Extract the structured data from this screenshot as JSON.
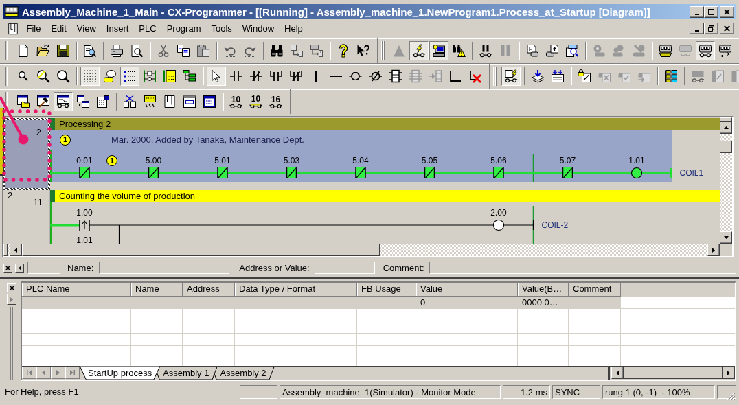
{
  "window": {
    "title": "Assembly_Machine_1_Main - CX-Programmer - [[Running] - Assembly_machine_1.NewProgram1.Process_at_Startup [Diagram]]"
  },
  "menu": [
    "File",
    "Edit",
    "View",
    "Insert",
    "PLC",
    "Program",
    "Tools",
    "Window",
    "Help"
  ],
  "toolbar_rows": [
    [
      {
        "groups": [
          [
            {
              "pressed": false,
              "disabled": false
            },
            {
              "pressed": false,
              "disabled": false
            },
            {
              "pressed": false,
              "disabled": false
            }
          ],
          [
            {
              "pressed": false,
              "disabled": false
            }
          ],
          [
            {
              "pressed": false,
              "disabled": false
            },
            {
              "pressed": false,
              "disabled": false
            }
          ],
          [
            {
              "pressed": false,
              "disabled": true
            },
            {
              "pressed": false,
              "disabled": false
            },
            {
              "pressed": false,
              "disabled": true
            }
          ],
          [
            {
              "pressed": false,
              "disabled": true
            },
            {
              "pressed": false,
              "disabled": true
            }
          ],
          [
            {
              "pressed": false,
              "disabled": false
            },
            {
              "pressed": false,
              "disabled": true
            },
            {
              "pressed": false,
              "disabled": true
            }
          ],
          [
            {
              "pressed": false,
              "disabled": false
            },
            {
              "pressed": false,
              "disabled": false
            }
          ]
        ]
      },
      {
        "groups": [
          [
            {
              "pressed": false,
              "disabled": true
            },
            {
              "pressed": true,
              "disabled": false
            },
            {
              "pressed": true,
              "disabled": false
            },
            {
              "pressed": false,
              "disabled": false
            }
          ],
          [
            {
              "pressed": false,
              "disabled": false
            },
            {
              "pressed": false,
              "disabled": true
            }
          ],
          [
            {
              "pressed": false,
              "disabled": false
            },
            {
              "pressed": false,
              "disabled": false
            },
            {
              "pressed": false,
              "disabled": false
            }
          ],
          [
            {
              "pressed": false,
              "disabled": true
            },
            {
              "pressed": false,
              "disabled": true
            },
            {
              "pressed": false,
              "disabled": true
            }
          ],
          [
            {
              "pressed": false,
              "disabled": false
            },
            {
              "pressed": false,
              "disabled": true
            },
            {
              "pressed": true,
              "disabled": false
            },
            {
              "pressed": false,
              "disabled": false
            }
          ]
        ]
      }
    ],
    [
      {
        "groups": [
          [
            {
              "pressed": false,
              "disabled": false
            },
            {
              "pressed": false,
              "disabled": false
            },
            {
              "pressed": false,
              "disabled": false
            }
          ],
          [
            {
              "pressed": true,
              "disabled": false
            },
            {
              "pressed": false,
              "disabled": false
            },
            {
              "pressed": true,
              "disabled": false
            },
            {
              "pressed": false,
              "disabled": false
            },
            {
              "pressed": false,
              "disabled": false
            },
            {
              "pressed": false,
              "disabled": false
            }
          ],
          [
            {
              "pressed": true,
              "disabled": false
            },
            {
              "pressed": false,
              "disabled": false
            },
            {
              "pressed": false,
              "disabled": false
            },
            {
              "pressed": false,
              "disabled": false
            },
            {
              "pressed": false,
              "disabled": false
            },
            {
              "pressed": false,
              "disabled": false
            },
            {
              "pressed": false,
              "disabled": false
            },
            {
              "pressed": false,
              "disabled": false
            },
            {
              "pressed": false,
              "disabled": false
            },
            {
              "pressed": false,
              "disabled": false
            },
            {
              "pressed": false,
              "disabled": true
            },
            {
              "pressed": false,
              "disabled": true
            },
            {
              "pressed": false,
              "disabled": false
            },
            {
              "pressed": false,
              "disabled": false
            }
          ]
        ]
      },
      {
        "groups": [
          [
            {
              "pressed": true,
              "disabled": false
            }
          ],
          [
            {
              "pressed": false,
              "disabled": false
            },
            {
              "pressed": false,
              "disabled": false
            }
          ],
          [
            {
              "pressed": false,
              "disabled": false
            },
            {
              "pressed": false,
              "disabled": true
            },
            {
              "pressed": false,
              "disabled": true
            },
            {
              "pressed": false,
              "disabled": true
            }
          ],
          [
            {
              "pressed": false,
              "disabled": false
            }
          ],
          [
            {
              "pressed": false,
              "disabled": true
            },
            {
              "pressed": false,
              "disabled": true
            },
            {
              "pressed": false,
              "disabled": true
            }
          ]
        ]
      }
    ],
    [
      {
        "groups": [
          [
            {
              "pressed": false,
              "disabled": false
            },
            {
              "pressed": false,
              "disabled": false
            },
            {
              "pressed": true,
              "disabled": false
            },
            {
              "pressed": false,
              "disabled": false
            },
            {
              "pressed": false,
              "disabled": false
            }
          ],
          [
            {
              "pressed": false,
              "disabled": false
            },
            {
              "pressed": false,
              "disabled": false
            },
            {
              "pressed": false,
              "disabled": false
            },
            {
              "pressed": false,
              "disabled": false
            },
            {
              "pressed": false,
              "disabled": false
            }
          ],
          [
            {
              "label": "10",
              "pressed": false,
              "disabled": false
            },
            {
              "label": "10",
              "pressed": false,
              "disabled": false
            },
            {
              "label": "16",
              "pressed": false,
              "disabled": false
            }
          ]
        ]
      }
    ]
  ],
  "ladder": {
    "rungs": [
      {
        "selected": true,
        "step": "2",
        "title": "Processing 2",
        "comment": {
          "marker": "1",
          "text": "Mar. 2000, Added by Tanaka, Maintenance Dept."
        },
        "rows": [
          [
            {
              "kind": "contact-nc",
              "address": "0.01",
              "on": true,
              "marker": "1"
            },
            {
              "kind": "contact-nc",
              "address": "5.00",
              "on": true
            },
            {
              "kind": "contact-nc",
              "address": "5.01",
              "on": true
            },
            {
              "kind": "contact-nc",
              "address": "5.03",
              "on": true
            },
            {
              "kind": "contact-nc",
              "address": "5.04",
              "on": true
            },
            {
              "kind": "contact-nc",
              "address": "5.05",
              "on": true
            },
            {
              "kind": "contact-nc",
              "address": "5.06",
              "on": true
            },
            {
              "kind": "contact-nc",
              "address": "5.07",
              "on": true
            },
            {
              "kind": "coil",
              "address": "1.01",
              "name": "COIL1",
              "on": true
            }
          ]
        ]
      },
      {
        "selected": false,
        "number": "2",
        "step": "11",
        "title": "Counting the volume of production",
        "rows": [
          [
            {
              "kind": "contact-rise",
              "address": "1.00",
              "on": false
            },
            {
              "kind": "coil",
              "address": "2.00",
              "name": "COIL-2",
              "on": false
            }
          ],
          [
            {
              "address": "1.01"
            }
          ]
        ]
      }
    ]
  },
  "find_bar": {
    "name_label": "Name:",
    "address_label": "Address or Value:",
    "comment_label": "Comment:"
  },
  "watch_table": {
    "columns": [
      "PLC Name",
      "Name",
      "Address",
      "Data Type / Format",
      "FB Usage",
      "Value",
      "Value(B…",
      "Comment"
    ],
    "rows": [
      {
        "selected": true,
        "cells": [
          "",
          "",
          "",
          "",
          "",
          "0",
          "0000 0…",
          ""
        ]
      }
    ],
    "sheets": [
      {
        "label": "StartUp process",
        "selected": true
      },
      {
        "label": "Assembly 1",
        "selected": false
      },
      {
        "label": "Assembly 2",
        "selected": false
      }
    ]
  },
  "status_bar": {
    "message": "For Help, press F1",
    "plc_status": "Assembly_machine_1(Simulator) - Monitor Mode",
    "cycle_time": "1.2 ms",
    "sync": "SYNC",
    "cursor": "rung 1 (0, -1)  - 100%"
  }
}
